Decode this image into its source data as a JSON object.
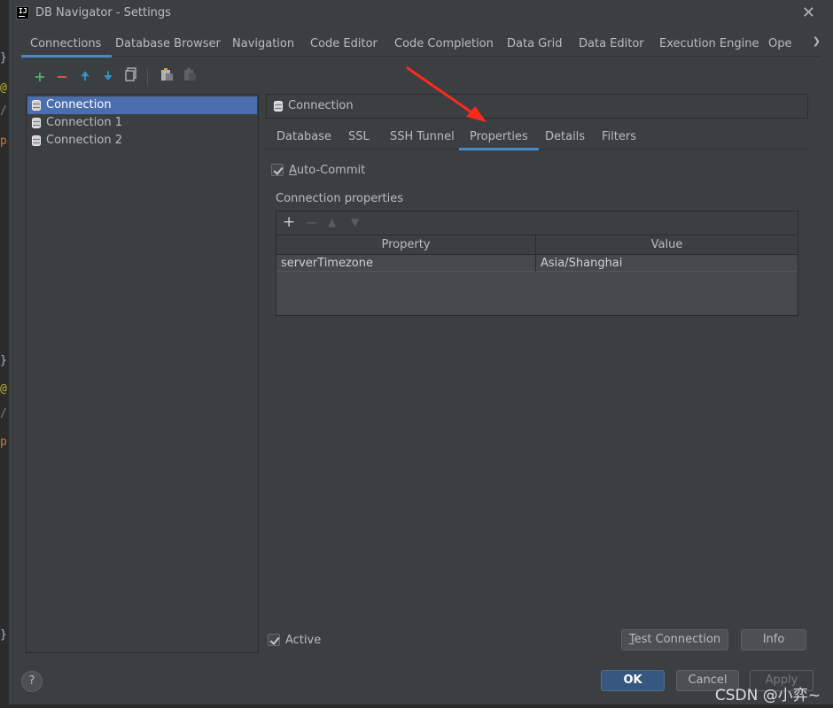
{
  "window": {
    "title": "DB Navigator - Settings",
    "app_icon_text": "IJ"
  },
  "background_gutter": [
    "}",
    "@",
    "/",
    "p",
    "}",
    "@",
    "/",
    "p",
    "}"
  ],
  "tabs": [
    {
      "label": "Connections"
    },
    {
      "label": "Database Browser"
    },
    {
      "label": "Navigation"
    },
    {
      "label": "Code Editor"
    },
    {
      "label": "Code Completion"
    },
    {
      "label": "Data Grid"
    },
    {
      "label": "Data Editor"
    },
    {
      "label": "Execution Engine"
    },
    {
      "label": "Ope"
    }
  ],
  "toolbar": {
    "add": "+",
    "remove": "−",
    "move_up": "🠉",
    "move_down": "🠋"
  },
  "connections": [
    {
      "label": "Connection",
      "selected": true
    },
    {
      "label": "Connection 1"
    },
    {
      "label": "Connection 2"
    }
  ],
  "detail": {
    "header": "Connection",
    "subtabs": [
      {
        "label": "Database"
      },
      {
        "label": "SSL"
      },
      {
        "label": "SSH Tunnel"
      },
      {
        "label": "Properties"
      },
      {
        "label": "Details"
      },
      {
        "label": "Filters"
      }
    ],
    "auto_commit_first": "A",
    "auto_commit_rest": "uto-Commit",
    "auto_commit_checked": true,
    "properties_section_label": "Connection properties",
    "properties_toolbar": {
      "add": "+",
      "remove": "−",
      "up": "▲",
      "down": "▼"
    },
    "properties_columns": [
      "Property",
      "Value"
    ],
    "properties_rows": [
      {
        "property": "serverTimezone",
        "value": "Asia/Shanghai"
      }
    ],
    "active_label": "Active",
    "active_checked": true,
    "test_connection_first": "T",
    "test_connection_rest": "est Connection",
    "info_label": "Info"
  },
  "footer": {
    "help": "?",
    "ok": "OK",
    "cancel": "Cancel",
    "apply": "Apply"
  },
  "watermark": "CSDN @小弈~",
  "colors": {
    "dialog_bg": "#3c3f41",
    "selection": "#4b6eaf",
    "primary_button": "#365880",
    "annotation_arrow": "#ff2a1a",
    "toolbar_add": "#59a869",
    "toolbar_remove": "#e05555",
    "toolbar_arrows": "#3592c4"
  }
}
